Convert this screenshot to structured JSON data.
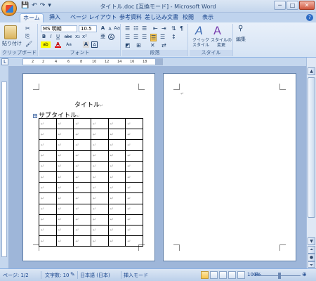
{
  "window": {
    "title": "タイトル.doc [互換モード] - Microsoft Word",
    "controls": {
      "minimize": "─",
      "maximize": "□",
      "close": "✕"
    }
  },
  "qat": {
    "save": "💾",
    "undo": "↶",
    "redo": "↷",
    "more": "▾"
  },
  "tabs": [
    {
      "label": "ホーム",
      "active": true
    },
    {
      "label": "挿入"
    },
    {
      "label": "ページ レイアウト"
    },
    {
      "label": "参考資料"
    },
    {
      "label": "差し込み文書"
    },
    {
      "label": "校閲"
    },
    {
      "label": "表示"
    }
  ],
  "ribbon": {
    "clipboard": {
      "label": "クリップボード",
      "paste": "貼り付け",
      "cut": "✂",
      "copy": "⎘",
      "format_painter": "🖌"
    },
    "font": {
      "label": "フォント",
      "font_name": "MS 明朝",
      "font_size": "10.5",
      "bold": "B",
      "italic": "I",
      "underline": "U",
      "strike": "abc",
      "subscript": "x₂",
      "superscript": "x²",
      "clear": "Aa",
      "font_color": "A",
      "highlight": "ab",
      "grow": "A",
      "shrink": "A",
      "phonetic": "亜",
      "enclose": "A"
    },
    "paragraph": {
      "label": "段落"
    },
    "styles": {
      "label": "スタイル",
      "quick_style": "クイック\nスタイル",
      "change_style": "スタイルの\n変更"
    },
    "editing": {
      "label": "編集",
      "button": "編集"
    }
  },
  "ruler": {
    "corner": "L",
    "numbers": [
      "2",
      "2",
      "4",
      "6",
      "8",
      "10",
      "12",
      "14",
      "16",
      "18"
    ]
  },
  "document": {
    "title": "タイトル",
    "subtitle": "サブタイトル",
    "return_mark": "↵",
    "table": {
      "rows": 12,
      "cols": 6
    }
  },
  "statusbar": {
    "page": "ページ: 1/2",
    "words": "文字数: 10",
    "language": "日本語 (日本)",
    "mode": "挿入モード",
    "zoom": "100%",
    "zoom_out": "⊖",
    "zoom_in": "⊕"
  }
}
